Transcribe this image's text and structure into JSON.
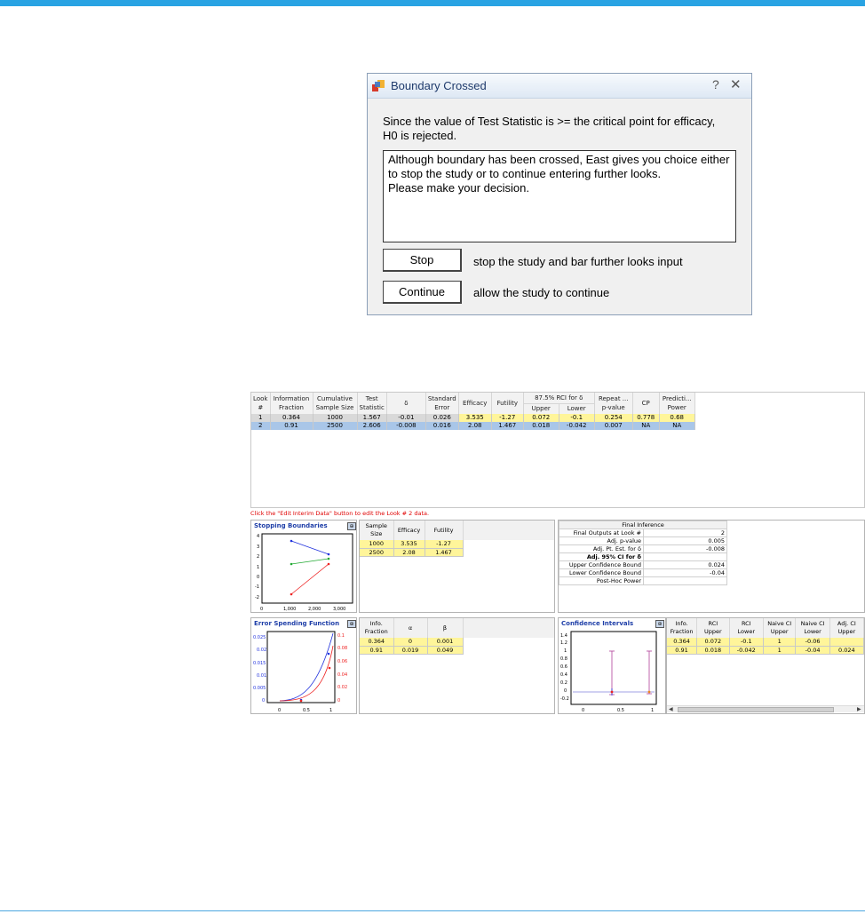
{
  "dialog": {
    "title": "Boundary Crossed",
    "help_glyph": "?",
    "close_glyph": "✕",
    "message_line1": "Since the value of Test Statistic is >= the critical point for efficacy,",
    "message_line2": "H0 is rejected.",
    "info_line1": "Although boundary has been crossed, East gives you choice either",
    "info_line2": "to stop the study or to continue entering further looks.",
    "info_line3": "Please make your decision.",
    "stop_label": "Stop",
    "stop_desc": "stop the study and bar further looks input",
    "continue_label": "Continue",
    "continue_desc": "allow the study to continue"
  },
  "grid": {
    "headers": {
      "look": [
        "Look",
        "#"
      ],
      "info": [
        "Information",
        "Fraction"
      ],
      "cum": [
        "Cumulative",
        "Sample Size"
      ],
      "test": [
        "Test",
        "Statistic"
      ],
      "delta": "δ",
      "se": [
        "Standard",
        "Error"
      ],
      "efficacy": "Efficacy",
      "futility": "Futility",
      "rci": "87.5% RCI for δ",
      "upper": "Upper",
      "lower": "Lower",
      "repeat": [
        "Repeat ...",
        "p-value"
      ],
      "cp": "CP",
      "pred": [
        "Predicti...",
        "Power"
      ]
    },
    "rows": [
      [
        "1",
        "0.364",
        "1000",
        "1.567",
        "-0.01",
        "0.026",
        "3.535",
        "-1.27",
        "0.072",
        "-0.1",
        "0.254",
        "0.778",
        "0.68"
      ],
      [
        "2",
        "0.91",
        "2500",
        "2.606",
        "-0.008",
        "0.016",
        "2.08",
        "1.467",
        "0.018",
        "-0.042",
        "0.007",
        "NA",
        "NA"
      ]
    ]
  },
  "note": "Click the \"Edit Interim Data\" button to edit the Look # 2 data.",
  "stopping": {
    "title": "Stopping Boundaries",
    "headers": [
      [
        "Sample",
        "Size"
      ],
      "Efficacy",
      "Futility"
    ],
    "rows": [
      [
        "1000",
        "3.535",
        "-1.27"
      ],
      [
        "2500",
        "2.08",
        "1.467"
      ]
    ],
    "y_ticks": [
      "4",
      "3",
      "2",
      "1",
      "0",
      "-1",
      "-2"
    ],
    "x_ticks": [
      "0",
      "1,000",
      "2,000",
      "3,000"
    ]
  },
  "final": {
    "title": "Final Inference",
    "rows": [
      [
        "Final Outputs at Look #",
        "2"
      ],
      [
        "Adj. p-value",
        "0.005"
      ],
      [
        "Adj. Pt. Est. for δ",
        "-0.008"
      ],
      [
        "Adj. 95% CI for δ",
        ""
      ],
      [
        "Upper Confidence Bound",
        "0.024"
      ],
      [
        "Lower Confidence Bound",
        "-0.04"
      ],
      [
        "Post-Hoc Power",
        ""
      ]
    ]
  },
  "error": {
    "title": "Error Spending Function",
    "headers": [
      [
        "Info.",
        "Fraction"
      ],
      "α",
      "β"
    ],
    "rows": [
      [
        "0.364",
        "0",
        "0.001"
      ],
      [
        "0.91",
        "0.019",
        "0.049"
      ]
    ],
    "y_left": [
      "0.025",
      "0.02",
      "0.015",
      "0.01",
      "0.005",
      "0"
    ],
    "y_right": [
      "0.1",
      "0.08",
      "0.06",
      "0.04",
      "0.02",
      "0"
    ],
    "x_ticks": [
      "0",
      "0.5",
      "1"
    ]
  },
  "ci": {
    "title": "Confidence Intervals",
    "headers": [
      [
        "Info.",
        "Fraction"
      ],
      [
        "RCI",
        "Upper"
      ],
      [
        "RCI",
        "Lower"
      ],
      [
        "Naive CI",
        "Upper"
      ],
      [
        "Naive CI",
        "Lower"
      ],
      [
        "Adj. CI",
        "Upper"
      ]
    ],
    "rows": [
      [
        "0.364",
        "0.072",
        "-0.1",
        "1",
        "-0.06",
        ""
      ],
      [
        "0.91",
        "0.018",
        "-0.042",
        "1",
        "-0.04",
        "0.024"
      ]
    ],
    "y_ticks": [
      "1.4",
      "1.2",
      "1",
      "0.8",
      "0.6",
      "0.4",
      "0.2",
      "0",
      "-0.2"
    ],
    "x_ticks": [
      "0",
      "0.5",
      "1"
    ]
  },
  "colors": {
    "accent": "#29a3e3",
    "highlight": "#fff59a",
    "selected_row": "#a9c6e8",
    "note_red": "#e00000"
  }
}
